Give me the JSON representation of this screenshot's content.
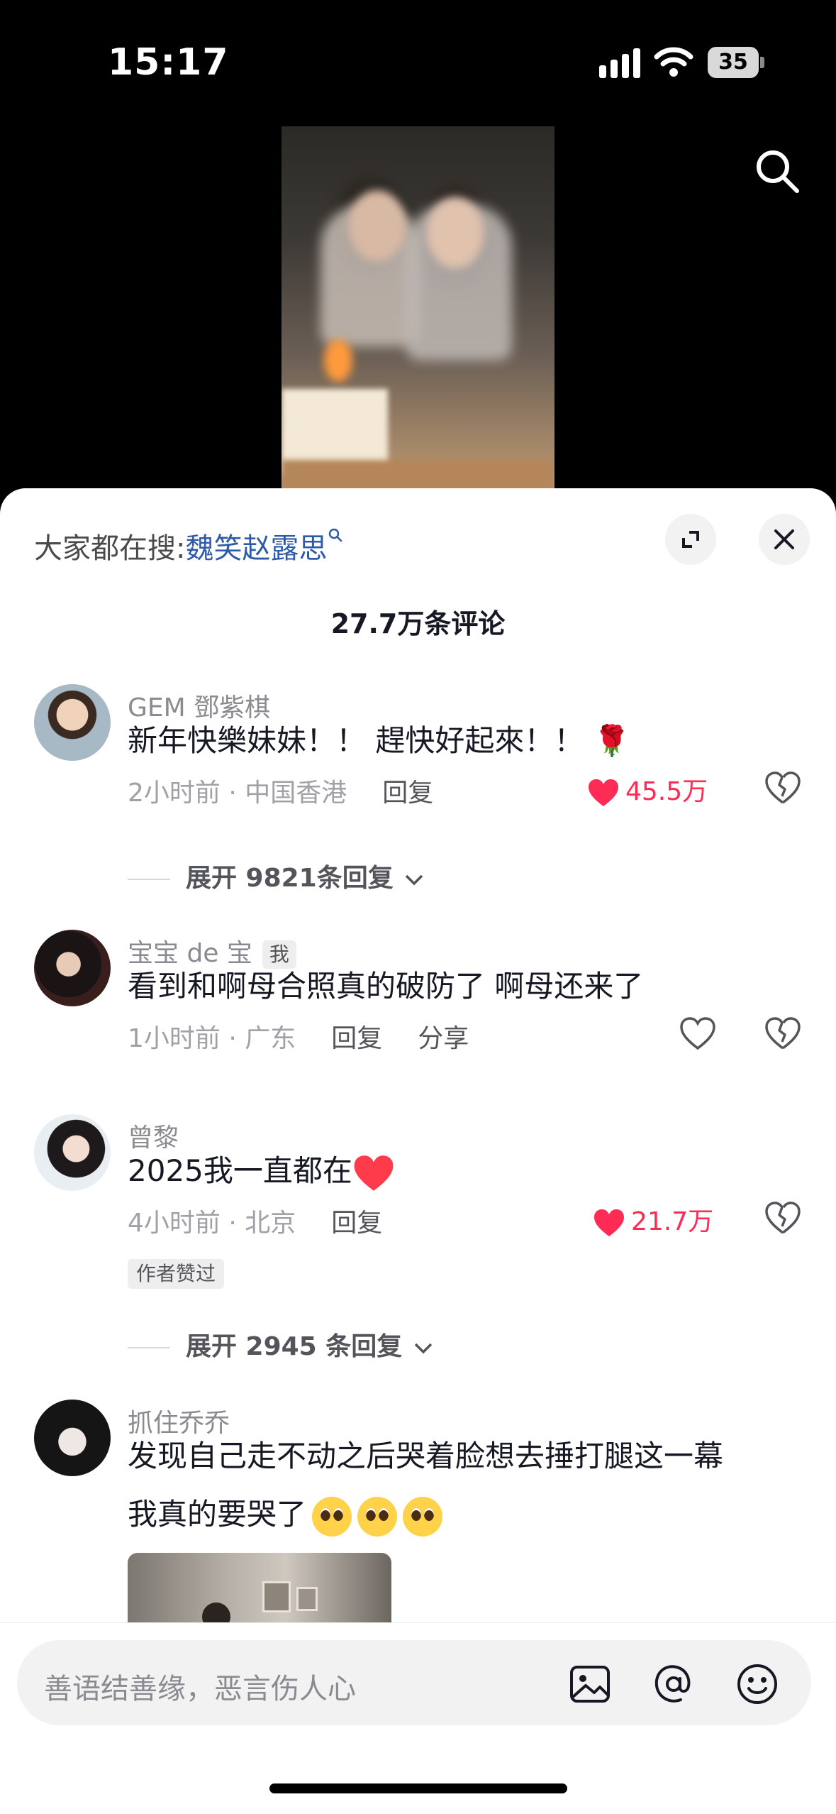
{
  "status_bar": {
    "time": "15:17",
    "battery": "35"
  },
  "hot_search": {
    "prefix": "大家都在搜:",
    "keyword": "魏笑赵露思"
  },
  "comment_count": "27.7万条评论",
  "comments": [
    {
      "user": "GEM 鄧紫棋",
      "text": "新年快樂妹妹！！ 趕快好起來！！ 🌹",
      "time_location": "2小时前 · 中国香港",
      "reply_label": "回复",
      "likes": "45.5万",
      "liked": true,
      "expand_replies": "展开 9821条回复"
    },
    {
      "user": "宝宝 de 宝",
      "user_tag": "我",
      "text": "看到和啊母合照真的破防了  啊母还来了",
      "time_location": "1小时前 · 广东",
      "reply_label": "回复",
      "share_label": "分享",
      "liked": false
    },
    {
      "user": "曾黎",
      "text": "2025我一直都在",
      "time_location": "4小时前 · 北京",
      "reply_label": "回复",
      "likes": "21.7万",
      "liked": true,
      "badge": "作者赞过",
      "expand_replies": "展开 2945 条回复"
    },
    {
      "user": "抓住乔乔",
      "text_line1": "发现自己走不动之后哭着脸想去捶打腿这一幕",
      "text_line2": "我真的要哭了"
    }
  ],
  "input_bar": {
    "placeholder": "善语结善缘，恶言伤人心"
  },
  "colors": {
    "like": "#fe2c55",
    "keyword": "#2e5aa8",
    "meta": "#a0a1a6"
  },
  "icons": [
    "signal-icon",
    "wifi-icon",
    "battery-icon",
    "search-icon",
    "expand-icon",
    "close-icon",
    "heart-icon",
    "broken-heart-icon",
    "chevron-down-icon",
    "image-icon",
    "at-icon",
    "emoji-icon"
  ]
}
